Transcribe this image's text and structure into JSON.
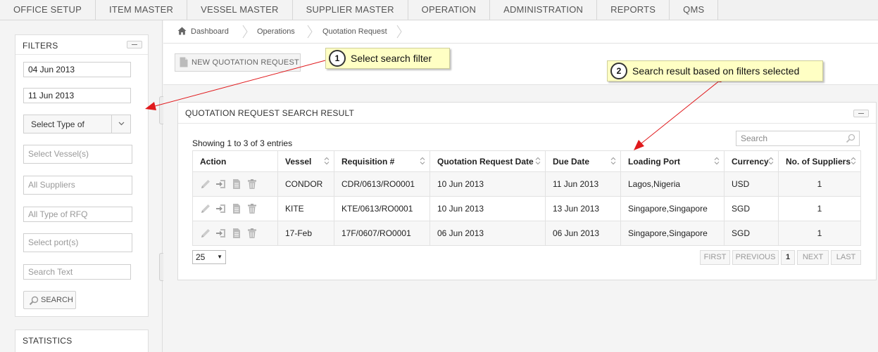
{
  "topnav": {
    "items": [
      "OFFICE SETUP",
      "ITEM MASTER",
      "VESSEL MASTER",
      "SUPPLIER MASTER",
      "OPERATION",
      "ADMINISTRATION",
      "REPORTS",
      "QMS"
    ]
  },
  "filters": {
    "title": "FILTERS",
    "date_from": "04 Jun 2013",
    "date_to": "11 Jun 2013",
    "type_select": "Select Type of",
    "vessels_placeholder": "Select Vessel(s)",
    "suppliers_placeholder": "All Suppliers",
    "rfq_placeholder": "All Type of RFQ",
    "ports_placeholder": "Select port(s)",
    "search_text_placeholder": "Search Text",
    "search_button": "SEARCH"
  },
  "statistics": {
    "title": "STATISTICS"
  },
  "breadcrumb": [
    "Dashboard",
    "Operations",
    "Quotation Request"
  ],
  "toolbar": {
    "new_button": "NEW QUOTATION REQUEST"
  },
  "results": {
    "title": "QUOTATION REQUEST SEARCH RESULT",
    "showing": "Showing 1 to 3 of 3 entries",
    "search_placeholder": "Search",
    "columns": [
      "Action",
      "Vessel",
      "Requisition #",
      "Quotation Request Date",
      "Due Date",
      "Loading Port",
      "Currency",
      "No. of Suppliers"
    ],
    "rows": [
      {
        "vessel": "CONDOR",
        "requisition": "CDR/0613/RO0001",
        "request_date": "10 Jun 2013",
        "due_date": "11 Jun 2013",
        "port": "Lagos,Nigeria",
        "currency": "USD",
        "suppliers": "1"
      },
      {
        "vessel": "KITE",
        "requisition": "KTE/0613/RO0001",
        "request_date": "10 Jun 2013",
        "due_date": "13 Jun 2013",
        "port": "Singapore,Singapore",
        "currency": "SGD",
        "suppliers": "1"
      },
      {
        "vessel": "17-Feb",
        "requisition": "17F/0607/RO0001",
        "request_date": "06 Jun 2013",
        "due_date": "06 Jun 2013",
        "port": "Singapore,Singapore",
        "currency": "SGD",
        "suppliers": "1"
      }
    ],
    "page_size": "25",
    "pager": {
      "first": "FIRST",
      "previous": "PREVIOUS",
      "current": "1",
      "next": "NEXT",
      "last": "LAST"
    }
  },
  "callouts": [
    {
      "num": "1",
      "text": "Select search filter"
    },
    {
      "num": "2",
      "text": "Search result based on filters selected"
    }
  ],
  "colors": {
    "callout_bg": "#ffffc4",
    "arrow": "#e0191c",
    "accent_border": "#dcdcdc"
  }
}
